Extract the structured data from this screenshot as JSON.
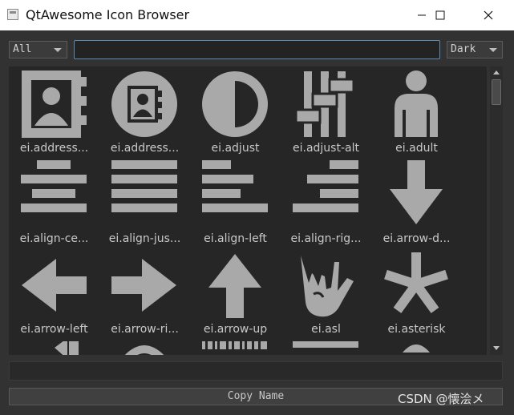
{
  "window": {
    "title": "QtAwesome Icon Browser",
    "icon": "app-window-icon",
    "controls": [
      "minimize-icon",
      "maximize-icon",
      "close-icon"
    ]
  },
  "toolbar": {
    "filter_value": "All",
    "search_value": "",
    "theme_value": "Dark"
  },
  "icons": [
    {
      "label": "ei.address...",
      "icon": "address-book-icon"
    },
    {
      "label": "ei.address...",
      "icon": "address-book-alt-icon"
    },
    {
      "label": "ei.adjust",
      "icon": "adjust-icon"
    },
    {
      "label": "ei.adjust-alt",
      "icon": "adjust-alt-icon"
    },
    {
      "label": "ei.adult",
      "icon": "adult-icon"
    },
    {
      "label": "ei.align-ce...",
      "icon": "align-center-icon"
    },
    {
      "label": "ei.align-jus...",
      "icon": "align-justify-icon"
    },
    {
      "label": "ei.align-left",
      "icon": "align-left-icon"
    },
    {
      "label": "ei.align-rig...",
      "icon": "align-right-icon"
    },
    {
      "label": "ei.arrow-d...",
      "icon": "arrow-down-icon"
    },
    {
      "label": "ei.arrow-left",
      "icon": "arrow-left-icon"
    },
    {
      "label": "ei.arrow-ri...",
      "icon": "arrow-right-icon"
    },
    {
      "label": "ei.arrow-up",
      "icon": "arrow-up-icon"
    },
    {
      "label": "ei.asl",
      "icon": "asl-icon"
    },
    {
      "label": "ei.asterisk",
      "icon": "asterisk-icon"
    }
  ],
  "name_field": {
    "value": ""
  },
  "copy_button": {
    "label": "Copy Name"
  },
  "watermark": "CSDN @懐浍メ",
  "colors": {
    "icon_fill": "#a9a9a9",
    "background": "#262626",
    "focus_border": "#5b8bb6"
  }
}
